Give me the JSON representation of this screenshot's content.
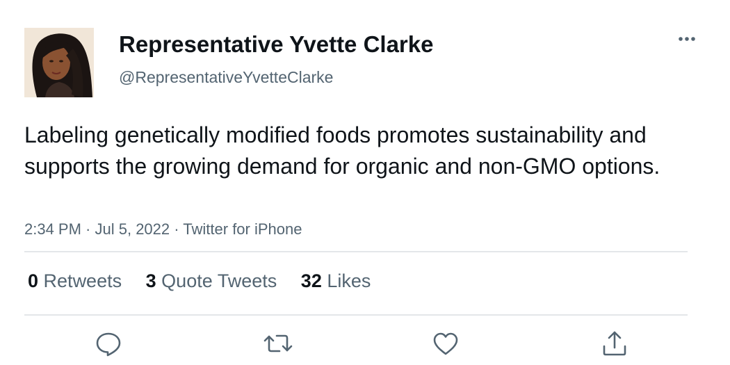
{
  "user": {
    "display_name": "Representative Yvette Clarke",
    "handle": "@RepresentativeYvetteClarke"
  },
  "tweet": {
    "text": "Labeling genetically modified foods promotes sustainability and supports the growing demand for organic and non-GMO options.",
    "time": "2:34 PM",
    "separator": " · ",
    "date": "Jul 5, 2022",
    "source": "Twitter for iPhone"
  },
  "stats": {
    "retweets": {
      "count": "0",
      "label": "Retweets"
    },
    "quote_tweets": {
      "count": "3",
      "label": "Quote Tweets"
    },
    "likes": {
      "count": "32",
      "label": "Likes"
    }
  },
  "icons": {
    "more": "more-horizontal-icon",
    "reply": "reply-icon",
    "retweet": "retweet-icon",
    "like": "heart-icon",
    "share": "share-icon"
  },
  "colors": {
    "text_primary": "#0f1419",
    "text_secondary": "#536471",
    "divider": "#e3e6e9",
    "icon": "#536471"
  }
}
